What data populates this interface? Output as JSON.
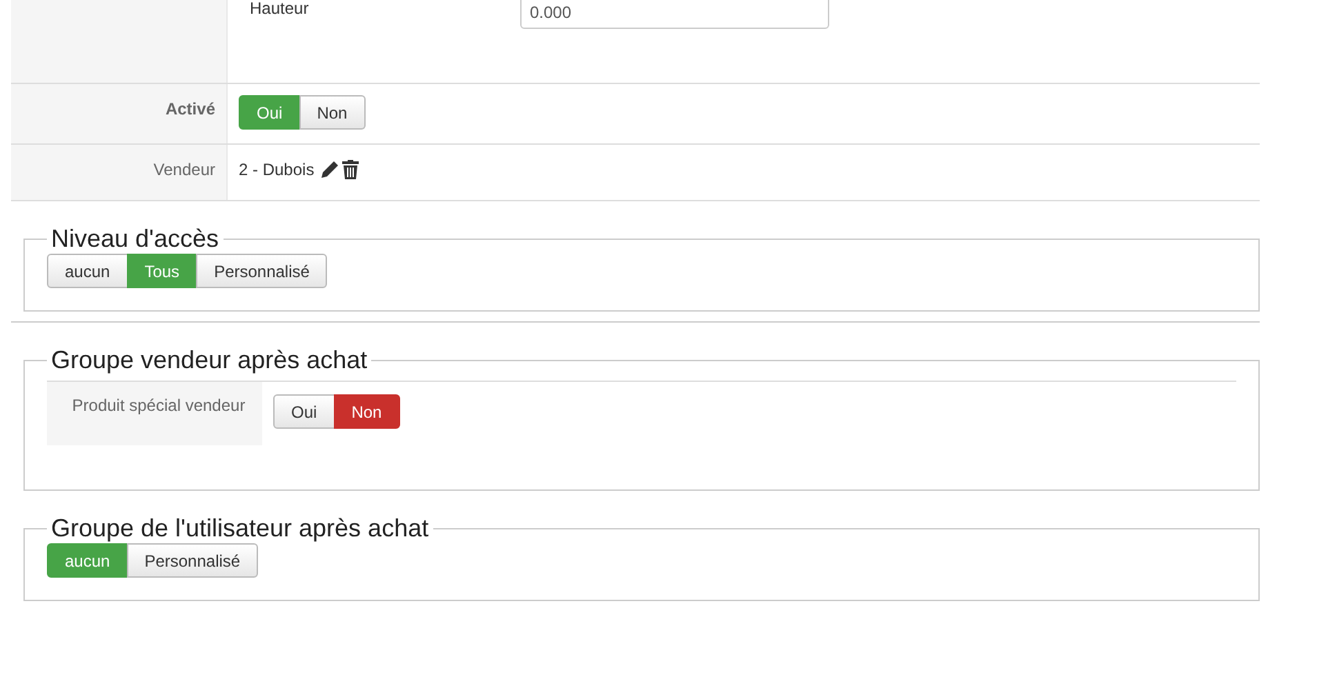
{
  "form_rows": [
    {
      "kind": "measure",
      "label": "",
      "sublabel": "Hauteur",
      "value": "0.000"
    },
    {
      "kind": "toggle",
      "label": "Activé",
      "bold": true,
      "options": [
        {
          "label": "Oui",
          "selected": true,
          "color": "#47a447"
        },
        {
          "label": "Non",
          "selected": false,
          "color": "#e6e6e6"
        }
      ]
    },
    {
      "kind": "vendor",
      "label": "Vendeur",
      "value": "2 - Dubois"
    }
  ],
  "sections": [
    {
      "legend": "Niveau d'accès",
      "options": [
        {
          "label": "aucun",
          "selected": false,
          "color": "#e6e6e6"
        },
        {
          "label": "Tous",
          "selected": true,
          "color": "#47a447"
        },
        {
          "label": "Personnalisé",
          "selected": false,
          "color": "#e6e6e6"
        }
      ],
      "divider_after": true
    },
    {
      "legend": "Groupe vendeur après achat",
      "row": {
        "label": "Produit spécial vendeur",
        "options": [
          {
            "label": "Oui",
            "selected": false,
            "color": "#e6e6e6"
          },
          {
            "label": "Non",
            "selected": true,
            "color": "#c9302c"
          }
        ]
      }
    },
    {
      "legend": "Groupe de l'utilisateur après achat",
      "options": [
        {
          "label": "aucun",
          "selected": true,
          "color": "#47a447"
        },
        {
          "label": "Personnalisé",
          "selected": false,
          "color": "#e6e6e6"
        }
      ]
    }
  ]
}
